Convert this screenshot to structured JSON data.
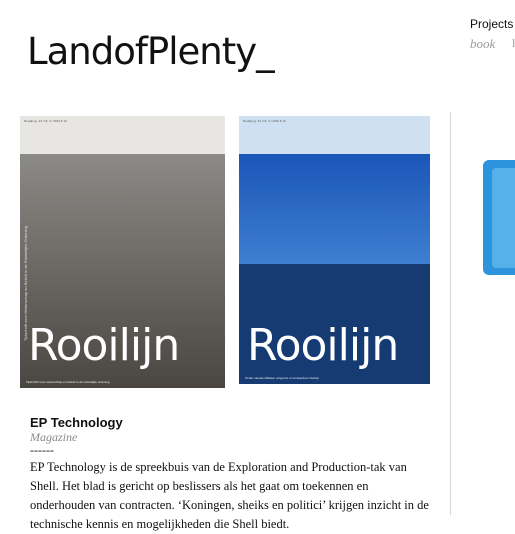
{
  "site": {
    "logo": "LandofPlenty_"
  },
  "nav": {
    "projects": "Projects",
    "book": "book",
    "sep": "l"
  },
  "covers": [
    {
      "word": "Rooilijn",
      "strip": "Rooilijn   jg. 43 / Nr. 3 / 2010   € 10",
      "vertical": "Tijdschrift voor Wetenschap en Beleid in de Ruimtelijke Ordening",
      "caption": "Tijdschrift voor wetenschap en beleid in de ruimtelijke ordening"
    },
    {
      "word": "Rooilijn",
      "strip": "Rooilijn   jg. 43 / Nr. 2 / 2010   € 10",
      "caption": "Onder nieuwe Alblaser volgvorm en Amsterdam Osdorp"
    }
  ],
  "project": {
    "title": "EP Technology",
    "type": "Magazine",
    "rule": "------",
    "description": "EP Technology is de spreekbuis van de Exploration and Production-tak van Shell. Het blad is gericht op beslissers als het gaat om toekennen en onderhouden van contracten. ‘Koningen, sheiks en politici’ krijgen inzicht in de technische kennis en mogelijkheden die Shell biedt."
  }
}
